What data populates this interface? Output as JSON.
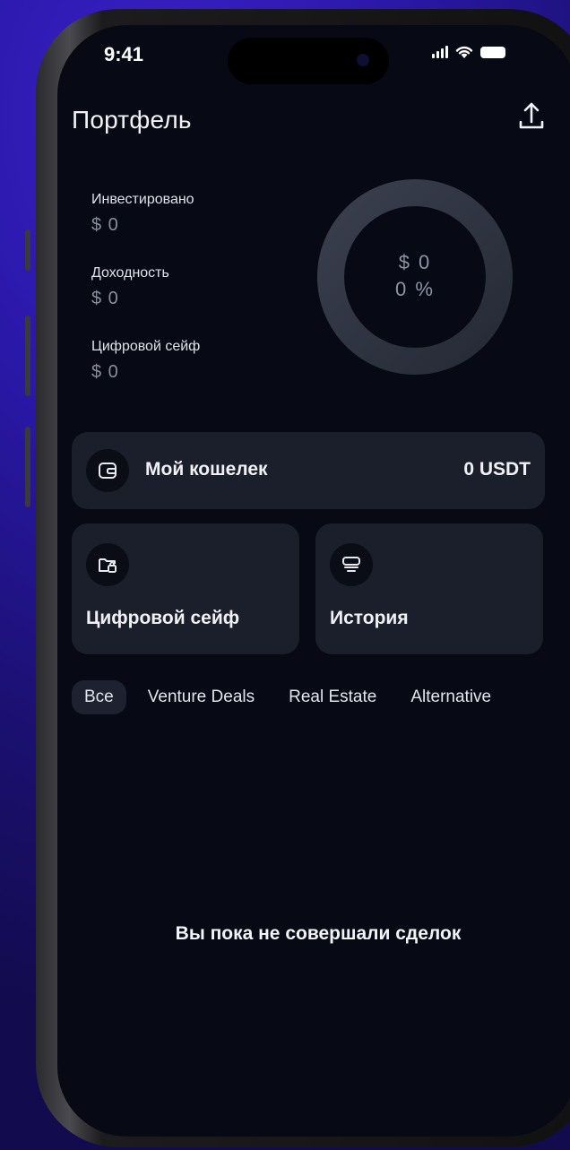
{
  "status_bar": {
    "time": "9:41"
  },
  "header": {
    "title": "Портфель",
    "share_icon": "share-upload-icon"
  },
  "stats": [
    {
      "label": "Инвестировано",
      "value": "$ 0"
    },
    {
      "label": "Доходность",
      "value": "$ 0"
    },
    {
      "label": "Цифровой сейф",
      "value": "$ 0"
    }
  ],
  "donut": {
    "amount": "$ 0",
    "percent": "0 %"
  },
  "wallet": {
    "label": "Мой кошелек",
    "amount": "0 USDT",
    "icon": "wallet-icon"
  },
  "tiles": [
    {
      "label": "Цифровой сейф",
      "icon": "folder-lock-icon"
    },
    {
      "label": "История",
      "icon": "history-stack-icon"
    }
  ],
  "tabs": [
    {
      "label": "Все",
      "active": true
    },
    {
      "label": "Venture Deals",
      "active": false
    },
    {
      "label": "Real Estate",
      "active": false
    },
    {
      "label": "Alternative",
      "active": false
    }
  ],
  "empty_state": "Вы пока не совершали сделок",
  "colors": {
    "background": "#070a14",
    "card": "#1b1f2b",
    "accent_bg": "#2a18a8"
  }
}
